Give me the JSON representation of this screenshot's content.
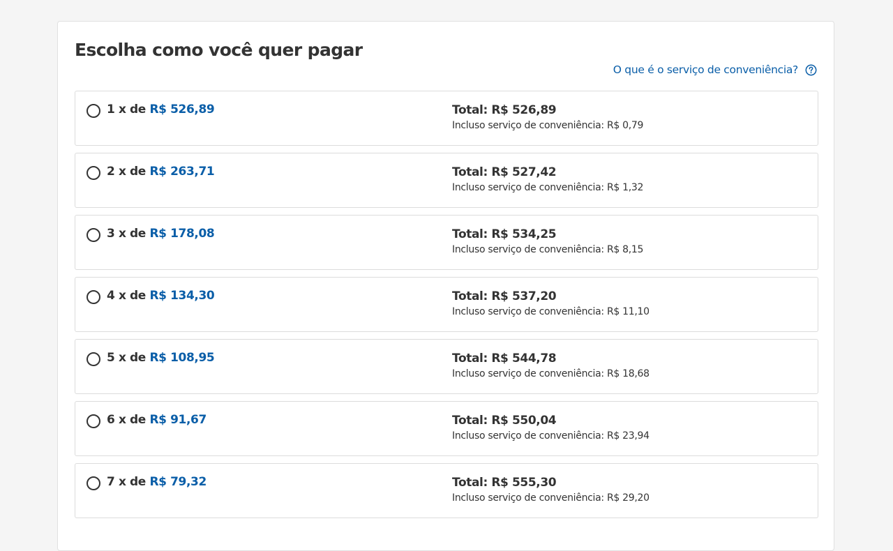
{
  "page": {
    "title": "Escolha como você quer pagar",
    "help_link": "O que é o serviço de conveniência?",
    "help_icon": "question-circle-icon"
  },
  "colors": {
    "accent": "#0a5ea8",
    "text": "#333333",
    "border": "#dcdcdc",
    "background": "#f5f5f5"
  },
  "options": [
    {
      "installment": "1 x de",
      "amount": "R$ 526,89",
      "total": "Total: R$ 526,89",
      "fee": "Incluso serviço de conveniência: R$ 0,79"
    },
    {
      "installment": "2 x de",
      "amount": "R$ 263,71",
      "total": "Total: R$ 527,42",
      "fee": "Incluso serviço de conveniência: R$ 1,32"
    },
    {
      "installment": "3 x de",
      "amount": "R$ 178,08",
      "total": "Total: R$ 534,25",
      "fee": "Incluso serviço de conveniência: R$ 8,15"
    },
    {
      "installment": "4 x de",
      "amount": "R$ 134,30",
      "total": "Total: R$ 537,20",
      "fee": "Incluso serviço de conveniência: R$ 11,10"
    },
    {
      "installment": "5 x de",
      "amount": "R$ 108,95",
      "total": "Total: R$ 544,78",
      "fee": "Incluso serviço de conveniência: R$ 18,68"
    },
    {
      "installment": "6 x de",
      "amount": "R$ 91,67",
      "total": "Total: R$ 550,04",
      "fee": "Incluso serviço de conveniência: R$ 23,94"
    },
    {
      "installment": "7 x de",
      "amount": "R$ 79,32",
      "total": "Total: R$ 555,30",
      "fee": "Incluso serviço de conveniência: R$ 29,20"
    }
  ]
}
